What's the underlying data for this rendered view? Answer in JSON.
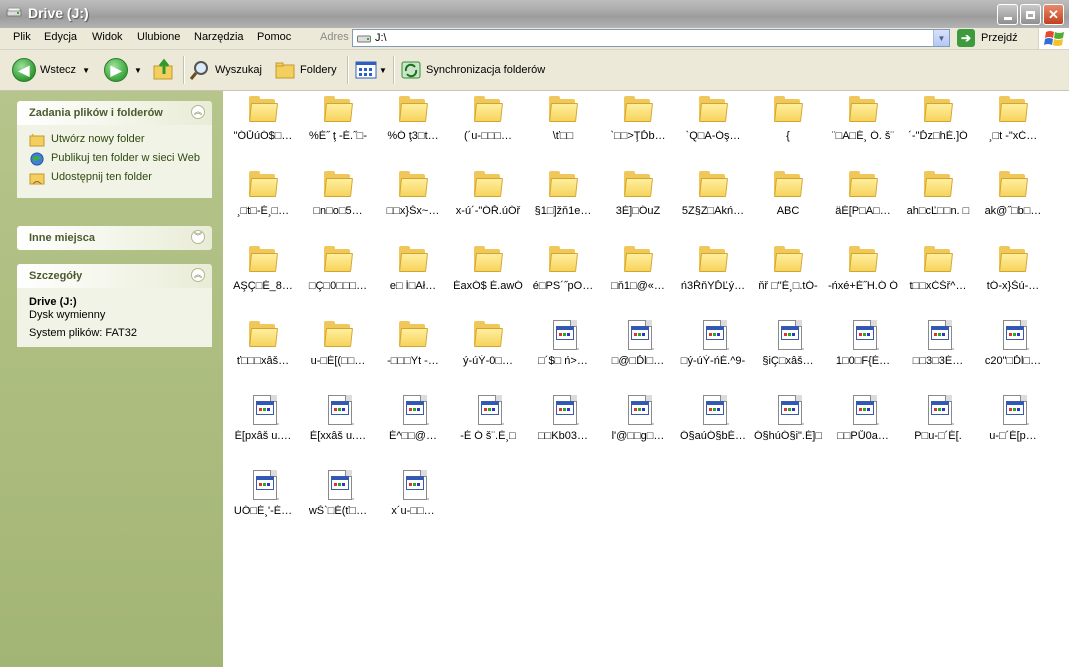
{
  "window": {
    "title": "Drive (J:)"
  },
  "menu": [
    "Plik",
    "Edycja",
    "Widok",
    "Ulubione",
    "Narzędzia",
    "Pomoc"
  ],
  "address": {
    "label": "Adres",
    "value": "J:\\",
    "go_label": "Przejdź"
  },
  "toolbar": {
    "back_label": "Wstecz",
    "search_label": "Wyszukaj",
    "folders_label": "Foldery",
    "sync_label": "Synchronizacja folderów"
  },
  "tasks_panel": {
    "title": "Zadania plików i folderów",
    "items": [
      "Utwórz nowy folder",
      "Publikuj ten folder w sieci Web",
      "Udostępnij ten folder"
    ]
  },
  "other_places": {
    "title": "Inne miejsca"
  },
  "details": {
    "title": "Szczegóły",
    "name": "Drive (J:)",
    "type": "Dysk wymienny",
    "fs": "System plików: FAT32"
  },
  "items": [
    {
      "type": "folder",
      "label": "\"ÓŮúÓ$□…"
    },
    {
      "type": "folder",
      "label": "%É˝ ţ -É.˝□-"
    },
    {
      "type": "folder",
      "label": "%Ó ţ3□t…"
    },
    {
      "type": "folder",
      "label": "(´u-□□□…"
    },
    {
      "type": "folder",
      "label": "\\ť□□"
    },
    {
      "type": "folder",
      "label": "`□□>ŢĎb…"
    },
    {
      "type": "folder",
      "label": "`Q□A-Óş…"
    },
    {
      "type": "folder",
      "label": "{"
    },
    {
      "type": "folder",
      "label": "¨□A□É¸ Ó. š¨"
    },
    {
      "type": "folder",
      "label": "´-\"Ďz□hÉ.]Ó"
    },
    {
      "type": "folder",
      "label": "¸□t -\"xĆ…"
    },
    {
      "type": "folder",
      "label": "¸□t□-É¸□…"
    },
    {
      "type": "folder",
      "label": "□n□o□5…"
    },
    {
      "type": "folder",
      "label": "□□x}Šx~…"
    },
    {
      "type": "folder",
      "label": "x-ú´-\"ÓŘ.úÓř"
    },
    {
      "type": "folder",
      "label": "§1□]žň1e…"
    },
    {
      "type": "folder",
      "label": "3É]□ÓuZ"
    },
    {
      "type": "folder",
      "label": "5Z§Z□Akń…"
    },
    {
      "type": "folder",
      "label": "ABC"
    },
    {
      "type": "folder",
      "label": "äÉ[P□A□…"
    },
    {
      "type": "folder",
      "label": "ah□cĽ□□n. □"
    },
    {
      "type": "folder",
      "label": "ak@˝□b□…"
    },
    {
      "type": "folder",
      "label": "AŞÇ□É_8…"
    },
    {
      "type": "folder",
      "label": "□Ç□0□□□…"
    },
    {
      "type": "folder",
      "label": "e□ Í□Ał…"
    },
    {
      "type": "folder",
      "label": "ÉaxÓ$ É.awÓ"
    },
    {
      "type": "folder",
      "label": "é□PS´˝pO…"
    },
    {
      "type": "folder",
      "label": "□ň1□@«…"
    },
    {
      "type": "folder",
      "label": "ń3ŘňYĎĽý…"
    },
    {
      "type": "folder",
      "label": "ňř □\"É¸□.tÓ-"
    },
    {
      "type": "folder",
      "label": "-ńxé+É˝H.Ó Ó"
    },
    {
      "type": "folder",
      "label": "t□□xĆŠř^…"
    },
    {
      "type": "folder",
      "label": "tÓ-x}Šú-…"
    },
    {
      "type": "folder",
      "label": "ť□□□xâš…"
    },
    {
      "type": "folder",
      "label": "u-□É[(□□…"
    },
    {
      "type": "folder",
      "label": "-□□□Yt -…"
    },
    {
      "type": "folder",
      "label": "ý-úÝ-0□…"
    },
    {
      "type": "file",
      "label": "□´$□ ń>…"
    },
    {
      "type": "file",
      "label": "□@□Ďĺ□…"
    },
    {
      "type": "file",
      "label": "□ý-úÝ-ńÉ.^9-"
    },
    {
      "type": "file",
      "label": "§iÇ□xâš…"
    },
    {
      "type": "file",
      "label": "1□0□F{É…"
    },
    {
      "type": "file",
      "label": "□□3□3É…"
    },
    {
      "type": "file",
      "label": "c20\"□Ďĺ□…"
    },
    {
      "type": "file",
      "label": "É[pxâš u.…"
    },
    {
      "type": "file",
      "label": "É[xxâš u.…"
    },
    {
      "type": "file",
      "label": "É^□□@…"
    },
    {
      "type": "file",
      "label": "-É Ó š¨.È¸□"
    },
    {
      "type": "file",
      "label": "□□Kb03…"
    },
    {
      "type": "file",
      "label": "l'@□□g□…"
    },
    {
      "type": "file",
      "label": "Ó§aúÓ§bÉ…"
    },
    {
      "type": "file",
      "label": "Ó§húÓ§i\".É]□"
    },
    {
      "type": "file",
      "label": "□□PŮ0a…"
    },
    {
      "type": "file",
      "label": "P□u-□´É[."
    },
    {
      "type": "file",
      "label": "u-□´É[p…"
    },
    {
      "type": "file",
      "label": "UÓ□É¸'-É…"
    },
    {
      "type": "file",
      "label": "wŠ`□É(ť□…"
    },
    {
      "type": "file",
      "label": "x´u-□□…"
    }
  ]
}
